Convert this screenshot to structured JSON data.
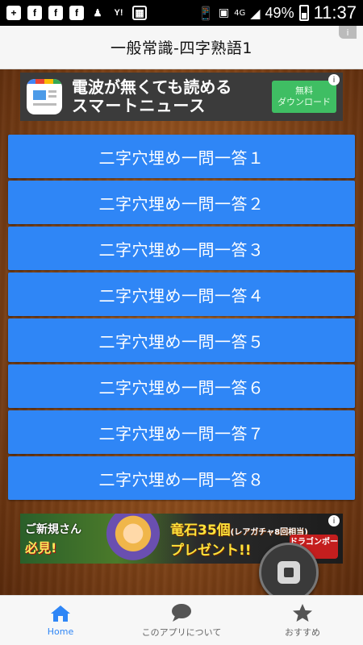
{
  "status_bar": {
    "left_icons": [
      "plus-icon",
      "facebook-icon",
      "facebook-icon",
      "facebook-icon",
      "person-icon",
      "yahoo-icon",
      "calculator-icon"
    ],
    "network": "4G",
    "battery": "49%",
    "time": "11:37"
  },
  "header": {
    "title": "一般常識-四字熟語1",
    "info": "i"
  },
  "ad_top": {
    "line1": "電波が無くても読める",
    "line2": "スマートニュース",
    "cta_line1": "無料",
    "cta_line2": "ダウンロード",
    "info": "i"
  },
  "buttons": [
    {
      "label": "二字穴埋め一問一答１"
    },
    {
      "label": "二字穴埋め一問一答２"
    },
    {
      "label": "二字穴埋め一問一答３"
    },
    {
      "label": "二字穴埋め一問一答４"
    },
    {
      "label": "二字穴埋め一問一答５"
    },
    {
      "label": "二字穴埋め一問一答６"
    },
    {
      "label": "二字穴埋め一問一答７"
    },
    {
      "label": "二字穴埋め一問一答８"
    }
  ],
  "ad_bottom": {
    "tag1": "ご新規さん",
    "tag2": "必見!",
    "main1": "竜石35個",
    "main1_note": "(レアガチャ8回相当)",
    "main2": "プレゼント!!",
    "logo": "ドラゴンポーカー",
    "info": "i"
  },
  "bottom_nav": {
    "items": [
      {
        "label": "Home",
        "icon": "home-icon",
        "active": true
      },
      {
        "label": "このアプリについて",
        "icon": "chat-bubble-icon",
        "active": false
      },
      {
        "label": "おすすめ",
        "icon": "star-icon",
        "active": false
      }
    ]
  },
  "colors": {
    "button": "#2f86f6",
    "nav_active": "#2f86f6",
    "wood": "#8d4d1c",
    "ad_cta": "#3fbe63"
  }
}
